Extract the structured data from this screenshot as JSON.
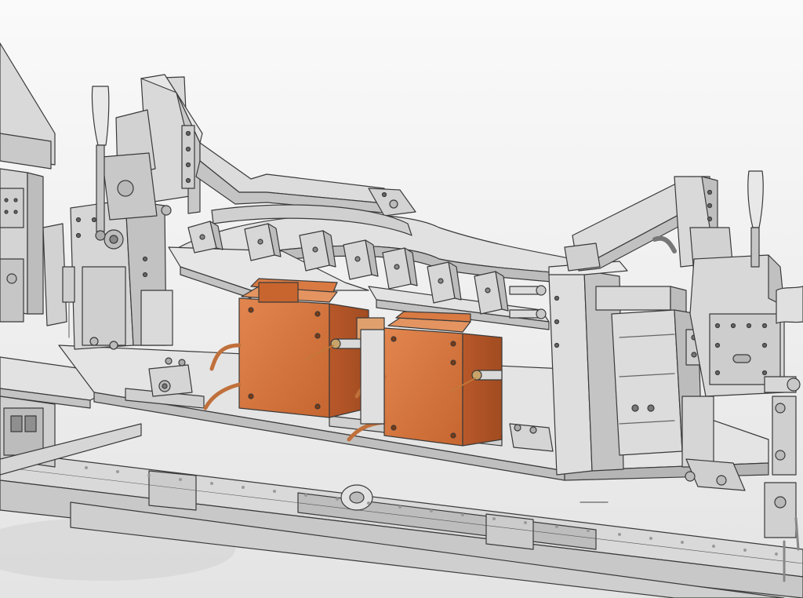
{
  "scene": {
    "subject": "cad-welding-fixture-render",
    "colors": {
      "background_top": "#f9f9f9",
      "background_bottom": "#e6e6e6",
      "steel": "#d8d8d8",
      "steel_light": "#e6e6e6",
      "steel_dark": "#b4b4b4",
      "edge": "#3c3c3c",
      "accent_orange": "#d2703a",
      "accent_orange_dark": "#a9521f",
      "accent_orange_light": "#e08b55",
      "brass": "#c8a46a"
    }
  }
}
